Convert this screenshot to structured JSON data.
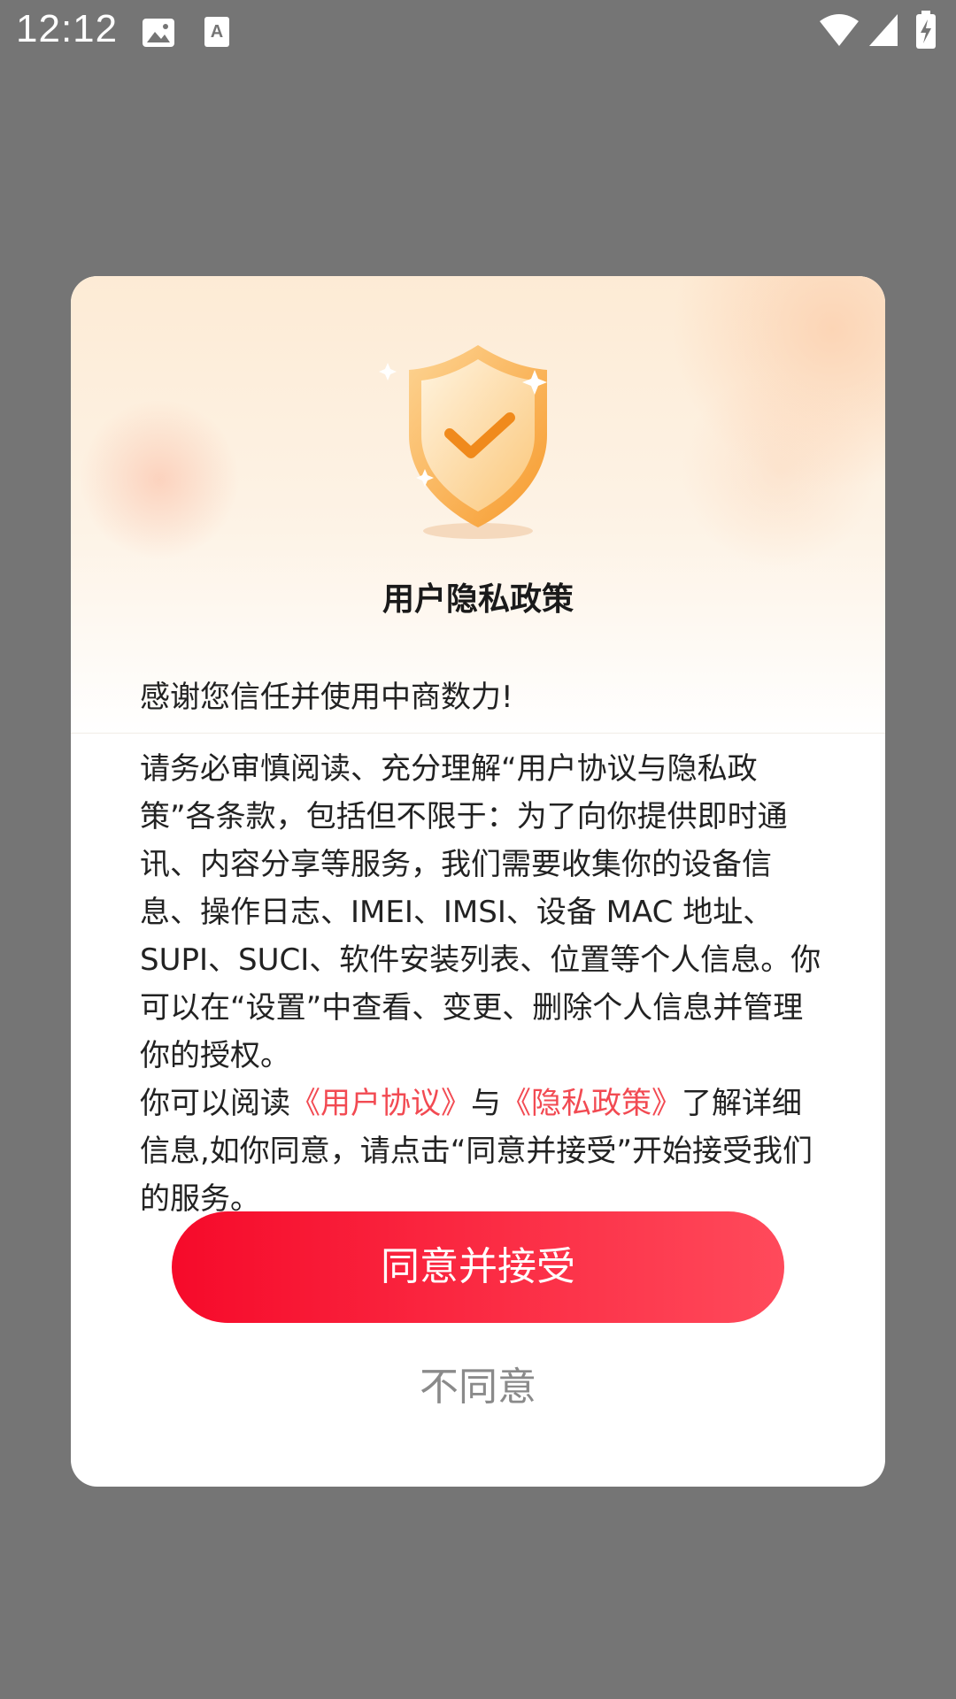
{
  "status_bar": {
    "time": "12:12",
    "icons": [
      "image-icon",
      "text-icon",
      "wifi-icon",
      "cell-signal-icon",
      "battery-charging-icon"
    ]
  },
  "dialog": {
    "title": "用户隐私政策",
    "thanks": "感谢您信任并使用中商数力!",
    "body_para1": "请务必审慎阅读、充分理解“用户协议与隐私政策”各条款，包括但不限于：为了向你提供即时通讯、内容分享等服务，我们需要收集你的设备信息、操作日志、IMEI、IMSI、设备 MAC 地址、SUPI、SUCI、软件安装列表、位置等个人信息。你可以在“设置”中查看、变更、删除个人信息并管理你的授权。",
    "body_para2_prefix": "你可以阅读",
    "user_agreement_link": "《用户协议》",
    "body_para2_and": "与",
    "privacy_policy_link": "《隐私政策》",
    "body_para2_suffix": "了解详细信息,如你同意，请点击“同意并接受”开始接受我们的服务。",
    "agree_label": "同意并接受",
    "decline_label": "不同意",
    "colors": {
      "accent": "#f60a2a",
      "accent_end": "#ff4a5b",
      "link": "#f24a52",
      "shield": "#fbb04a"
    }
  }
}
